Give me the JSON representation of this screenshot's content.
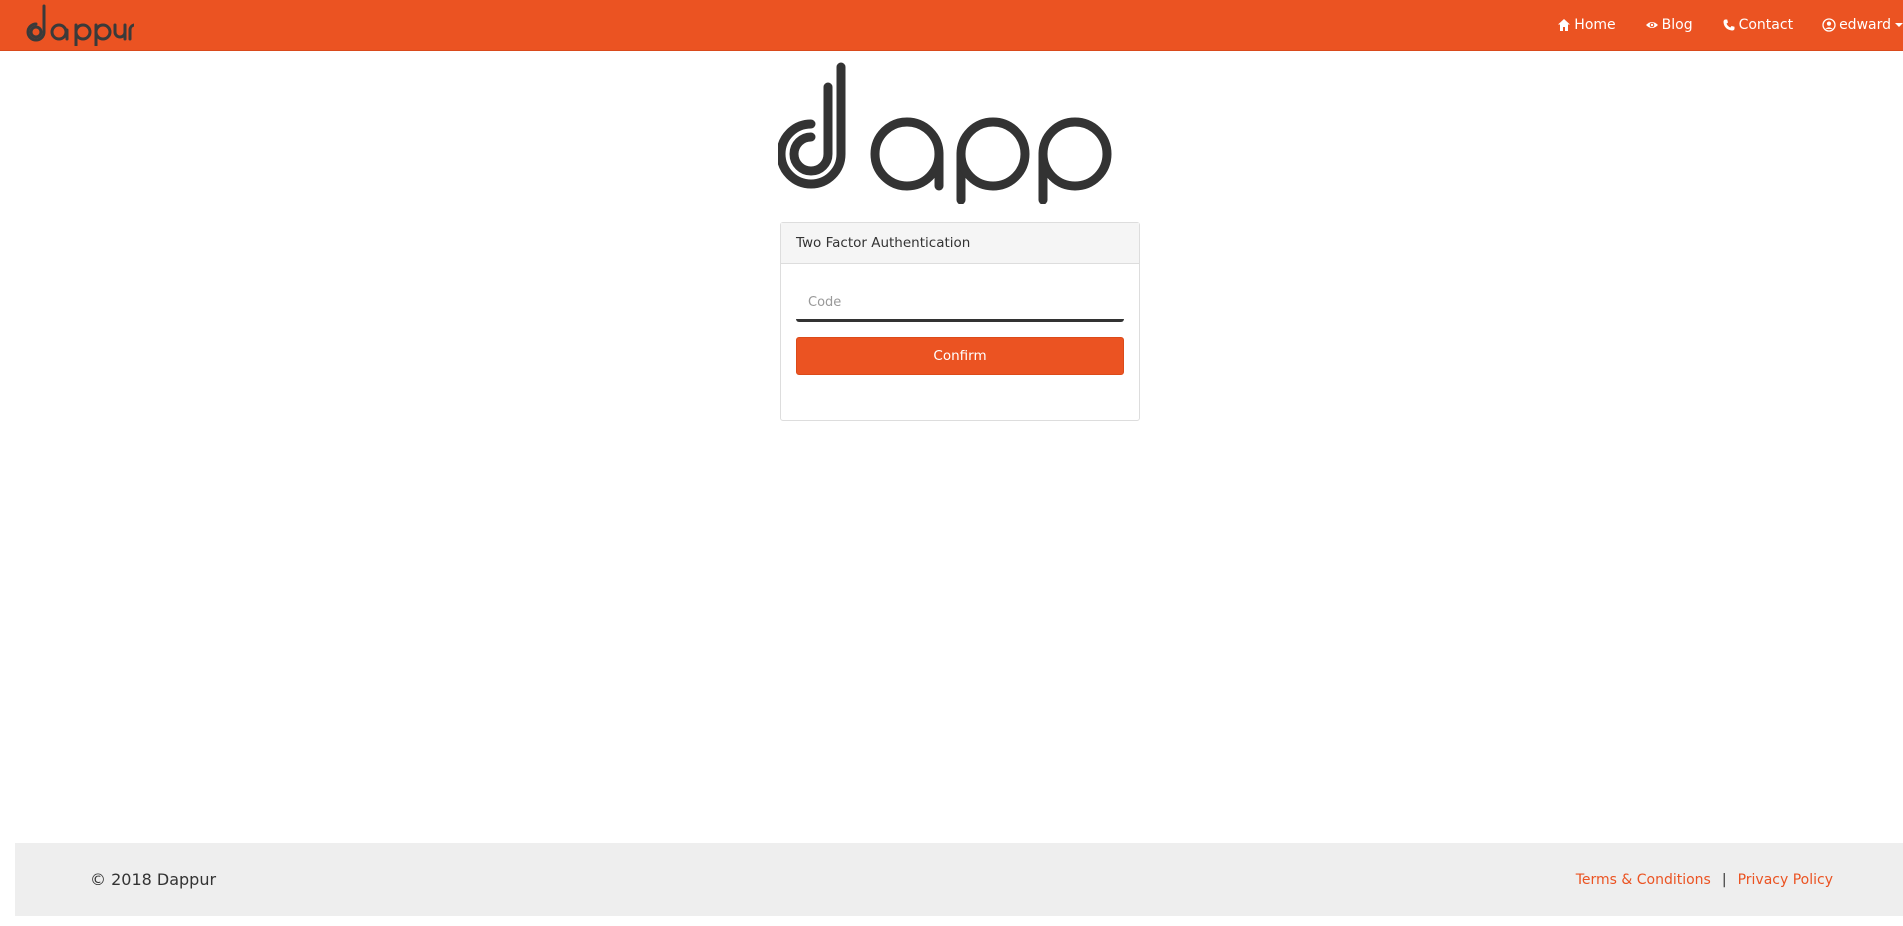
{
  "brand": {
    "name": "dappur",
    "accent_color": "#EB5322",
    "logo_color": "#333333"
  },
  "nav": {
    "items": [
      {
        "label": "Home",
        "icon": "home-icon"
      },
      {
        "label": "Blog",
        "icon": "eye-icon"
      },
      {
        "label": "Contact",
        "icon": "phone-icon"
      }
    ],
    "user": {
      "label": "edward",
      "icon": "user-circle-icon"
    }
  },
  "panel": {
    "heading": "Two Factor Authentication",
    "code_placeholder": "Code",
    "code_value": "",
    "confirm_label": "Confirm"
  },
  "footer": {
    "copyright": "© 2018 Dappur",
    "terms_label": "Terms & Conditions",
    "separator": "|",
    "privacy_label": "Privacy Policy"
  }
}
